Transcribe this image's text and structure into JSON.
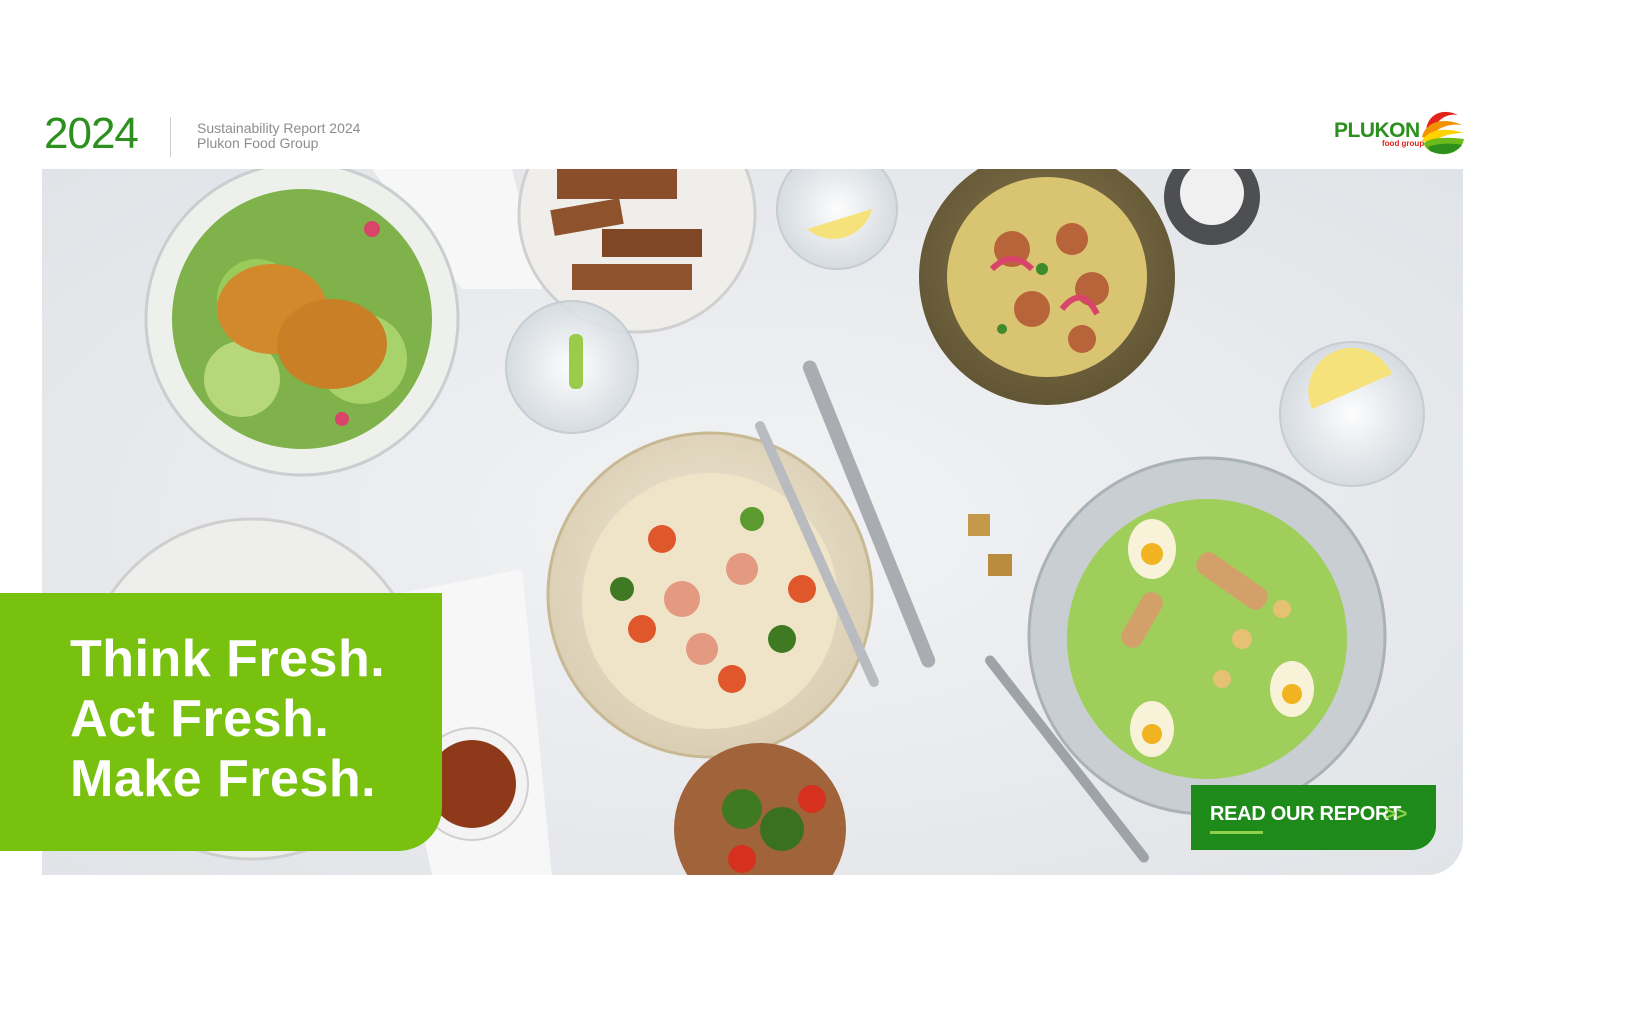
{
  "header": {
    "year": "2024",
    "report_title": "Sustainability Report 2024",
    "company": "Plukon Food Group"
  },
  "logo": {
    "wordmark": "PLUKON",
    "subtext": "food group"
  },
  "hero": {
    "image_description": "food-spread-photo",
    "slogan": [
      "Think Fresh.",
      "Act Fresh.",
      "Make Fresh."
    ]
  },
  "cta": {
    "label": "READ OUR REPORT",
    "arrow": ">>"
  },
  "colors": {
    "brand_green": "#2c8f1e",
    "lime_green": "#78c10f",
    "cta_green": "#1d8a1a",
    "brand_red": "#e2231a",
    "brand_orange": "#f39200",
    "brand_yellow": "#ffd200"
  }
}
